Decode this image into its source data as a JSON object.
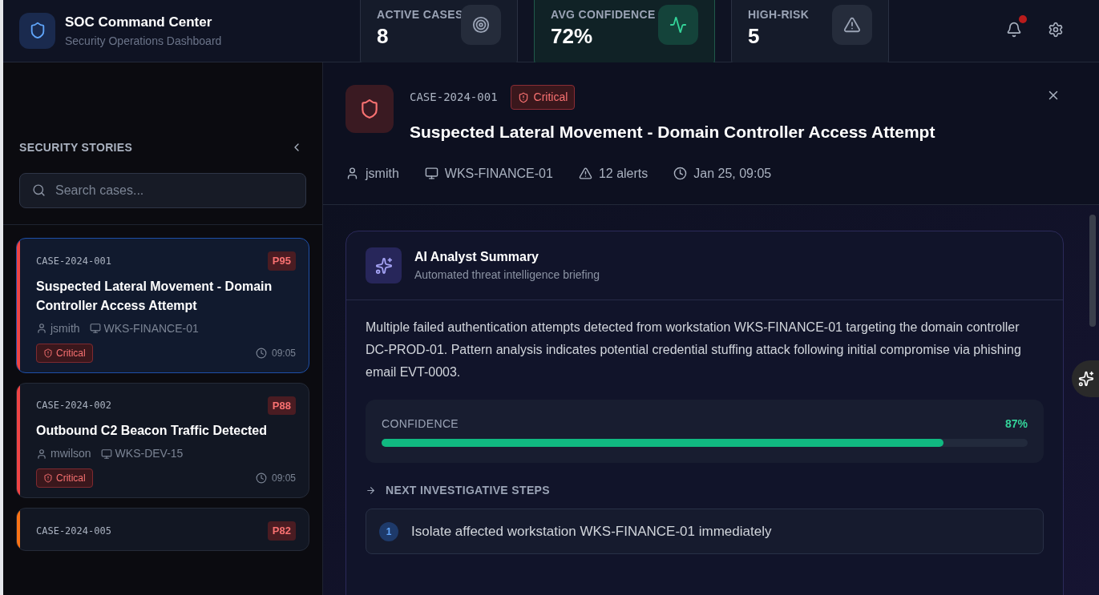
{
  "app": {
    "title": "SOC Command Center",
    "subtitle": "Security Operations Dashboard"
  },
  "stats": [
    {
      "kind": "target",
      "label": "ACTIVE CASES",
      "value": "8",
      "highlighted": false
    },
    {
      "kind": "pulse",
      "label": "AVG CONFIDENCE",
      "value": "72%",
      "highlighted": true
    },
    {
      "kind": "alert",
      "label": "HIGH-RISK",
      "value": "5",
      "highlighted": false
    }
  ],
  "notifications": {
    "unread": true
  },
  "sidebar": {
    "title": "SECURITY STORIES",
    "search": {
      "placeholder": "Search cases..."
    },
    "cases": [
      {
        "id": "CASE-2024-001",
        "priority": "P95",
        "title": "Suspected Lateral Movement - Domain Controller Access Attempt",
        "user": "jsmith",
        "host": "WKS-FINANCE-01",
        "severity": "Critical",
        "time": "09:05",
        "color": "#ef4444",
        "selected": true
      },
      {
        "id": "CASE-2024-002",
        "priority": "P88",
        "title": "Outbound C2 Beacon Traffic Detected",
        "user": "mwilson",
        "host": "WKS-DEV-15",
        "severity": "Critical",
        "time": "09:05",
        "color": "#ef4444",
        "selected": false
      },
      {
        "id": "CASE-2024-005",
        "priority": "P82",
        "color": "#f97316",
        "selected": false
      }
    ]
  },
  "detail": {
    "case_id": "CASE-2024-001",
    "severity": "Critical",
    "title": "Suspected Lateral Movement - Domain Controller Access Attempt",
    "user": "jsmith",
    "host": "WKS-FINANCE-01",
    "alerts": "12 alerts",
    "time": "Jan 25, 09:05",
    "summary": {
      "title": "AI Analyst Summary",
      "subtitle": "Automated threat intelligence briefing",
      "text": "Multiple failed authentication attempts detected from workstation WKS-FINANCE-01 targeting the domain controller DC-PROD-01. Pattern analysis indicates potential credential stuffing attack following initial compromise via phishing email EVT-0003.",
      "confidence": {
        "label": "CONFIDENCE",
        "reading": "87%",
        "level": 0.87
      },
      "steps_title": "NEXT INVESTIGATIVE STEPS",
      "steps": [
        {
          "number": "1",
          "text": "Isolate affected workstation WKS-FINANCE-01 immediately"
        }
      ]
    }
  }
}
